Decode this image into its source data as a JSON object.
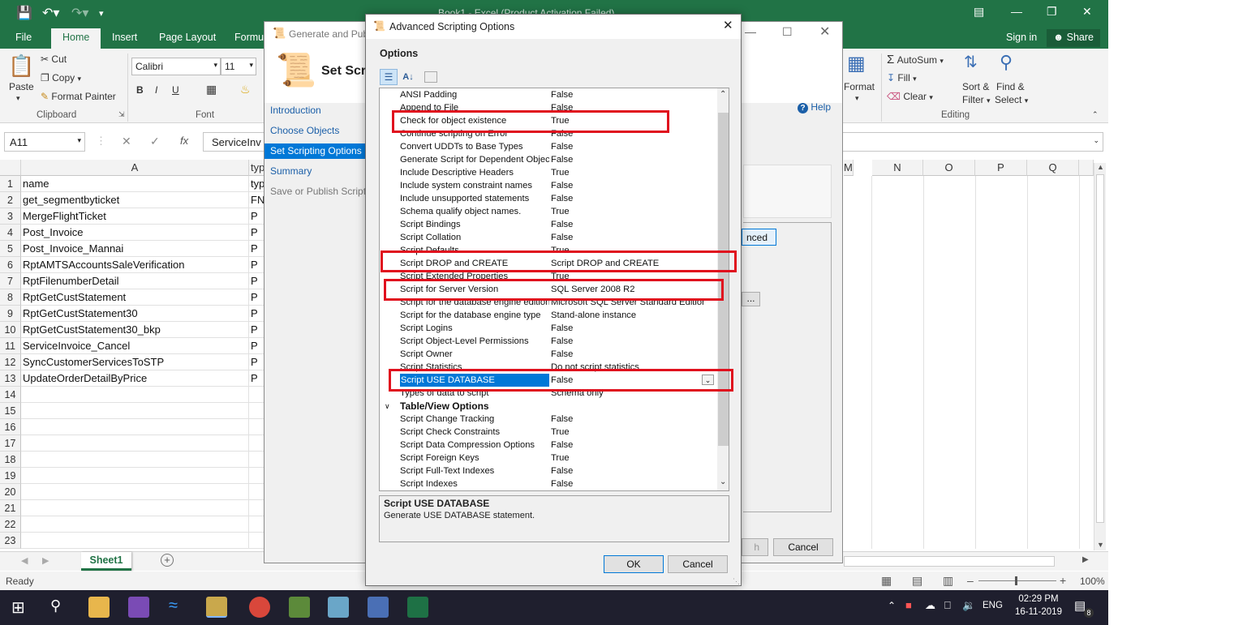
{
  "excel": {
    "title": "Book1 - Excel (Product Activation Failed)",
    "tabs": [
      "File",
      "Home",
      "Insert",
      "Page Layout",
      "Formu"
    ],
    "sign_in": "Sign in",
    "share": "Share",
    "clipboard": {
      "paste": "Paste",
      "cut": "Cut",
      "copy": "Copy",
      "format_painter": "Format Painter",
      "group": "Clipboard"
    },
    "font": {
      "name": "Calibri",
      "size": "11",
      "group": "Font",
      "bold": "B",
      "italic": "I",
      "underline": "U"
    },
    "right": {
      "format": "Format",
      "autosum": "AutoSum",
      "fill": "Fill",
      "clear": "Clear",
      "sort_filter_1": "Sort &",
      "sort_filter_2": "Filter",
      "find_select_1": "Find &",
      "find_select_2": "Select",
      "editing_group": "Editing"
    },
    "name_box": "A11",
    "fx": "fx",
    "formula_value": "ServiceInv",
    "columns_left": [
      "A",
      "typ"
    ],
    "columns_right": [
      "M",
      "N",
      "O",
      "P",
      "Q"
    ],
    "rows": [
      {
        "num": "1",
        "a": "name",
        "b": "typ"
      },
      {
        "num": "2",
        "a": "get_segmentbyticket",
        "b": "FN"
      },
      {
        "num": "3",
        "a": "MergeFlightTicket",
        "b": "P"
      },
      {
        "num": "4",
        "a": "Post_Invoice",
        "b": "P"
      },
      {
        "num": "5",
        "a": "Post_Invoice_Mannai",
        "b": "P"
      },
      {
        "num": "6",
        "a": "RptAMTSAccountsSaleVerification",
        "b": "P"
      },
      {
        "num": "7",
        "a": "RptFilenumberDetail",
        "b": "P"
      },
      {
        "num": "8",
        "a": "RptGetCustStatement",
        "b": "P"
      },
      {
        "num": "9",
        "a": "RptGetCustStatement30",
        "b": "P"
      },
      {
        "num": "10",
        "a": "RptGetCustStatement30_bkp",
        "b": "P"
      },
      {
        "num": "11",
        "a": "ServiceInvoice_Cancel",
        "b": "P"
      },
      {
        "num": "12",
        "a": "SyncCustomerServicesToSTP",
        "b": "P"
      },
      {
        "num": "13",
        "a": "UpdateOrderDetailByPrice",
        "b": "P"
      },
      {
        "num": "14",
        "a": "",
        "b": ""
      },
      {
        "num": "15",
        "a": "",
        "b": ""
      },
      {
        "num": "16",
        "a": "",
        "b": ""
      },
      {
        "num": "17",
        "a": "",
        "b": ""
      },
      {
        "num": "18",
        "a": "",
        "b": ""
      },
      {
        "num": "19",
        "a": "",
        "b": ""
      },
      {
        "num": "20",
        "a": "",
        "b": ""
      },
      {
        "num": "21",
        "a": "",
        "b": ""
      },
      {
        "num": "22",
        "a": "",
        "b": ""
      },
      {
        "num": "23",
        "a": "",
        "b": ""
      }
    ],
    "sheet_tab": "Sheet1",
    "status": "Ready",
    "zoom": "100%"
  },
  "wizard": {
    "title": "Generate and Publ",
    "heading": "Set Scr",
    "help": "Help",
    "nav": [
      "Introduction",
      "Choose Objects",
      "Set Scripting Options",
      "Summary",
      "Save or Publish Scripts"
    ],
    "advanced_btn": "nced",
    "ellipsis": "...",
    "finish": "h",
    "cancel": "Cancel"
  },
  "advanced": {
    "title": "Advanced Scripting Options",
    "options_label": "Options",
    "rows": [
      {
        "name": "ANSI Padding",
        "value": "False"
      },
      {
        "name": "Append to File",
        "value": "False"
      },
      {
        "name": "Check for object existence",
        "value": "True"
      },
      {
        "name": "Continue scripting on Error",
        "value": "False"
      },
      {
        "name": "Convert UDDTs to Base Types",
        "value": "False"
      },
      {
        "name": "Generate Script for Dependent Objects",
        "value": "False"
      },
      {
        "name": "Include Descriptive Headers",
        "value": "True"
      },
      {
        "name": "Include system constraint names",
        "value": "False"
      },
      {
        "name": "Include unsupported statements",
        "value": "False"
      },
      {
        "name": "Schema qualify object names.",
        "value": "True"
      },
      {
        "name": "Script Bindings",
        "value": "False"
      },
      {
        "name": "Script Collation",
        "value": "False"
      },
      {
        "name": "Script Defaults",
        "value": "True"
      },
      {
        "name": "Script DROP and CREATE",
        "value": "Script DROP and CREATE"
      },
      {
        "name": "Script Extended Properties",
        "value": "True"
      },
      {
        "name": "Script for Server Version",
        "value": "SQL Server 2008 R2"
      },
      {
        "name": "Script for the database engine edition",
        "value": "Microsoft SQL Server Standard Edition"
      },
      {
        "name": "Script for the database engine type",
        "value": "Stand-alone instance"
      },
      {
        "name": "Script Logins",
        "value": "False"
      },
      {
        "name": "Script Object-Level Permissions",
        "value": "False"
      },
      {
        "name": "Script Owner",
        "value": "False"
      },
      {
        "name": "Script Statistics",
        "value": "Do not script statistics"
      },
      {
        "name": "Script USE DATABASE",
        "value": "False"
      },
      {
        "name": "Types of data to script",
        "value": "Schema only"
      }
    ],
    "category": "Table/View Options",
    "table_rows": [
      {
        "name": "Script Change Tracking",
        "value": "False"
      },
      {
        "name": "Script Check Constraints",
        "value": "True"
      },
      {
        "name": "Script Data Compression Options",
        "value": "False"
      },
      {
        "name": "Script Foreign Keys",
        "value": "True"
      },
      {
        "name": "Script Full-Text Indexes",
        "value": "False"
      },
      {
        "name": "Script Indexes",
        "value": "False"
      }
    ],
    "desc_title": "Script USE DATABASE",
    "desc_text": "Generate USE DATABASE statement.",
    "ok": "OK",
    "cancel": "Cancel"
  },
  "taskbar": {
    "lang": "ENG",
    "time": "02:29 PM",
    "date": "16-11-2019",
    "notif_count": "8"
  },
  "colors": {
    "excel_green": "#217346",
    "highlight_red": "#e0101e",
    "selection_blue": "#0078d7",
    "taskbar": "#1f1f2e"
  }
}
